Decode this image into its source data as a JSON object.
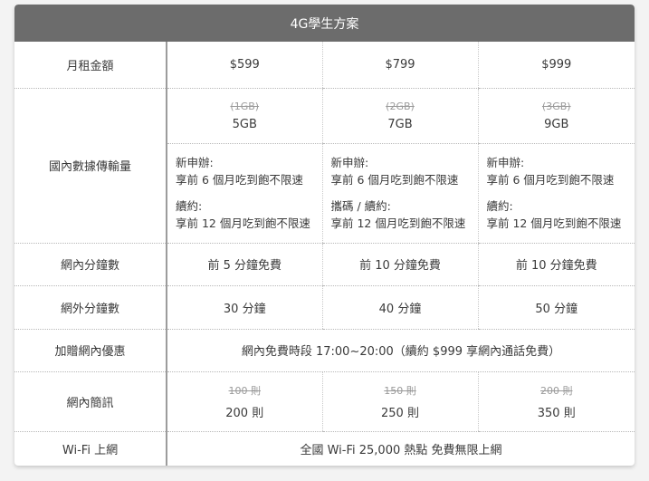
{
  "title": "4G學生方案",
  "rows": {
    "monthly_fee": {
      "label": "月租金額",
      "values": [
        "$599",
        "$799",
        "$999"
      ]
    },
    "data": {
      "label": "國內數據傳輸量",
      "old": [
        "(1GB)",
        "(2GB)",
        "(3GB)"
      ],
      "new": [
        "5GB",
        "7GB",
        "9GB"
      ],
      "promo": [
        {
          "a_title": "新申辦:",
          "a_text": "享前 6 個月吃到飽不限速",
          "b_title": "續約:",
          "b_text": "享前 12 個月吃到飽不限速"
        },
        {
          "a_title": "新申辦:",
          "a_text": "享前 6 個月吃到飽不限速",
          "b_title": "攜碼 / 續約:",
          "b_text": "享前 12 個月吃到飽不限速"
        },
        {
          "a_title": "新申辦:",
          "a_text": "享前 6 個月吃到飽不限速",
          "b_title": "續約:",
          "b_text": "享前 12 個月吃到飽不限速"
        }
      ]
    },
    "onnet_minutes": {
      "label": "網內分鐘數",
      "values": [
        "前 5 分鐘免費",
        "前 10 分鐘免費",
        "前 10 分鐘免費"
      ]
    },
    "offnet_minutes": {
      "label": "網外分鐘數",
      "values": [
        "30 分鐘",
        "40 分鐘",
        "50 分鐘"
      ]
    },
    "onnet_bonus": {
      "label": "加贈網內優惠",
      "value": "網內免費時段 17:00~20:00（續約 $999 享網內通話免費）"
    },
    "sms": {
      "label": "網內簡訊",
      "old": [
        "100 則",
        "150 則",
        "200 則"
      ],
      "new": [
        "200 則",
        "250 則",
        "350 則"
      ]
    },
    "wifi": {
      "label": "Wi-Fi 上網",
      "value": "全國 Wi-Fi 25,000 熱點 免費無限上網"
    }
  }
}
